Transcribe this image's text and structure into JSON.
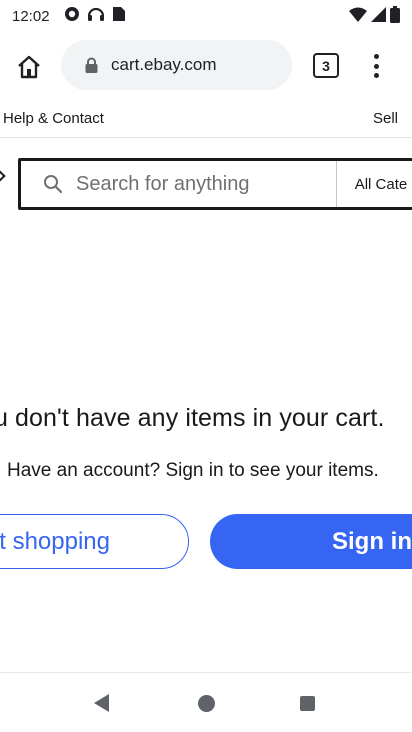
{
  "status_bar": {
    "time": "12:02",
    "left_icons": [
      "record-icon",
      "headset-icon",
      "sim-card-icon"
    ],
    "right_icons": [
      "wifi-icon",
      "cell-signal-icon",
      "battery-icon"
    ]
  },
  "browser": {
    "url": "cart.ebay.com",
    "tab_count": "3"
  },
  "page": {
    "help_link": "Help & Contact",
    "sell_link": "Sell",
    "search": {
      "placeholder": "Search for anything",
      "category": "All Cate"
    },
    "empty_message": "u don't have any items in your cart.",
    "sub_message": "Have an account? Sign in to see your items.",
    "continue_label": "t shopping",
    "signin_label": "Sign in"
  },
  "colors": {
    "accent": "#3665f3",
    "text": "#191919",
    "omnibox": "#f1f3f4"
  }
}
